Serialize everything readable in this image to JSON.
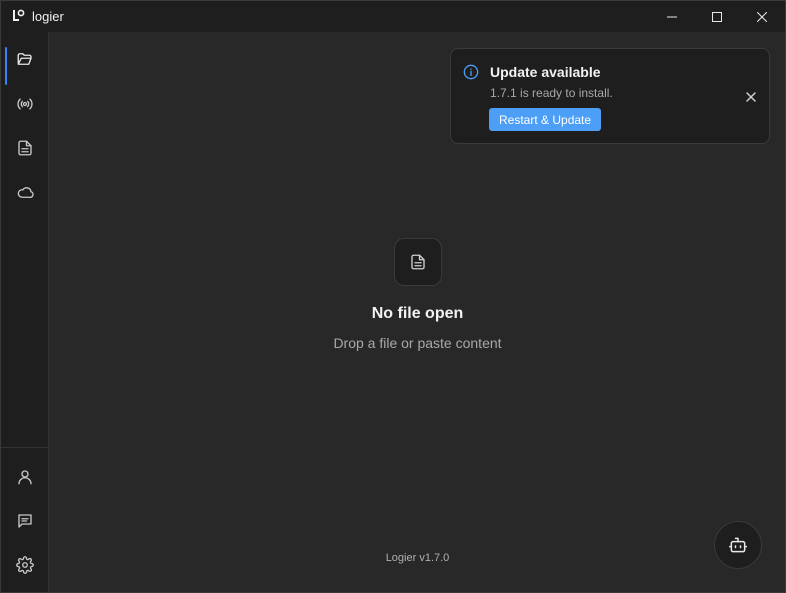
{
  "window": {
    "title": "logier",
    "logo_icon": "logier-logo-icon",
    "controls": [
      "minimize-icon",
      "maximize-icon",
      "close-icon"
    ]
  },
  "sidebar": {
    "top_items": [
      {
        "icon": "folder-open-icon",
        "active": true
      },
      {
        "icon": "broadcast-icon",
        "active": false
      },
      {
        "icon": "document-icon",
        "active": false
      },
      {
        "icon": "cloud-icon",
        "active": false
      }
    ],
    "bottom_items": [
      {
        "icon": "user-icon"
      },
      {
        "icon": "chat-icon"
      },
      {
        "icon": "gear-icon"
      }
    ],
    "accent_color": "#3b82f6"
  },
  "empty_state": {
    "icon": "file-icon",
    "title": "No file open",
    "subtitle": "Drop a file or paste content"
  },
  "footer": {
    "version": "Logier v1.7.0"
  },
  "assistant_button": {
    "icon": "bot-icon"
  },
  "toast": {
    "icon": "info-icon",
    "title": "Update available",
    "message": "1.7.1 is ready to install.",
    "action_label": "Restart & Update",
    "action_color": "#4d9ef6",
    "close_icon": "close-icon"
  }
}
